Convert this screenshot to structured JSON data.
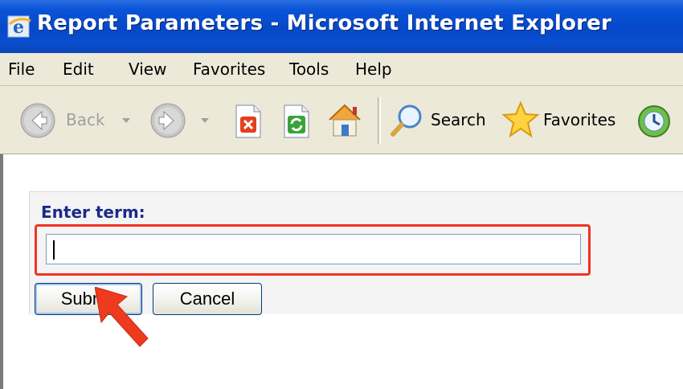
{
  "window": {
    "title": "Report Parameters - Microsoft Internet Explorer",
    "icon": "ie-icon"
  },
  "menu": {
    "items": [
      "File",
      "Edit",
      "View",
      "Favorites",
      "Tools",
      "Help"
    ]
  },
  "toolbar": {
    "back_label": "Back",
    "search_label": "Search",
    "favorites_label": "Favorites"
  },
  "form": {
    "label": "Enter term:",
    "input_value": "",
    "submit_label": "Submit",
    "cancel_label": "Cancel"
  },
  "colors": {
    "title_bar": "#0548c8",
    "label_text": "#1c2b8a",
    "highlight_border": "#f13322",
    "pointer_arrow": "#ee3b1f"
  }
}
